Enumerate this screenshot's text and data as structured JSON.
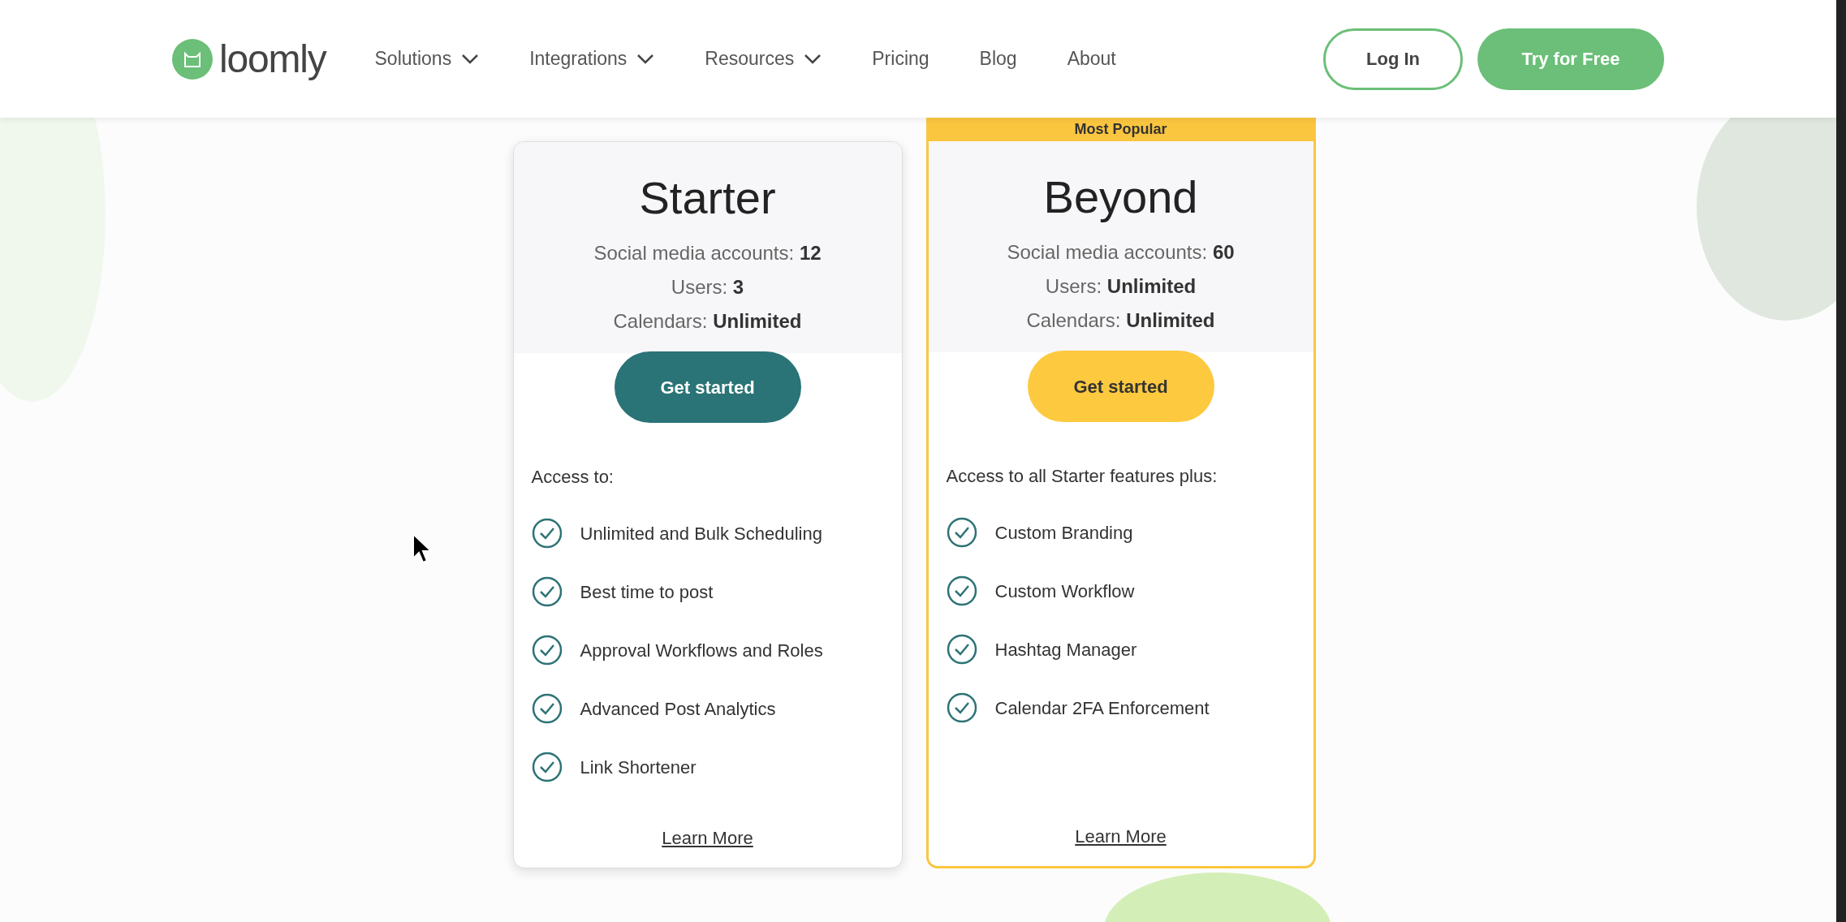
{
  "header": {
    "logo": "loomly",
    "nav": [
      {
        "label": "Solutions",
        "dropdown": true
      },
      {
        "label": "Integrations",
        "dropdown": true
      },
      {
        "label": "Resources",
        "dropdown": true
      },
      {
        "label": "Pricing",
        "dropdown": false
      },
      {
        "label": "Blog",
        "dropdown": false
      },
      {
        "label": "About",
        "dropdown": false
      }
    ],
    "buttons": [
      {
        "label": "Log In",
        "kind": "outline"
      },
      {
        "label": "Try for Free",
        "kind": "filled"
      }
    ]
  },
  "plans": [
    {
      "name": "Starter",
      "featured": false,
      "stats": [
        {
          "label": "Social media accounts:",
          "value": "12"
        },
        {
          "label": "Users:",
          "value": "3"
        },
        {
          "label": "Calendars:",
          "value": "Unlimited"
        }
      ],
      "button": "Get started",
      "access_title": "Access to:",
      "features": [
        "Unlimited and Bulk Scheduling",
        "Best time to post",
        "Approval Workflows and Roles",
        "Advanced Post Analytics",
        "Link Shortener"
      ],
      "link": "Learn More"
    },
    {
      "name": "Beyond",
      "featured": true,
      "badge": "Most Popular",
      "stats": [
        {
          "label": "Social media accounts:",
          "value": "60"
        },
        {
          "label": "Users:",
          "value": "Unlimited"
        },
        {
          "label": "Calendars:",
          "value": "Unlimited"
        }
      ],
      "button": "Get started",
      "access_title": "Access to all Starter features plus:",
      "features": [
        "Custom Branding",
        "Custom Workflow",
        "Hashtag Manager",
        "Calendar 2FA Enforcement"
      ],
      "link": "Learn More"
    }
  ]
}
